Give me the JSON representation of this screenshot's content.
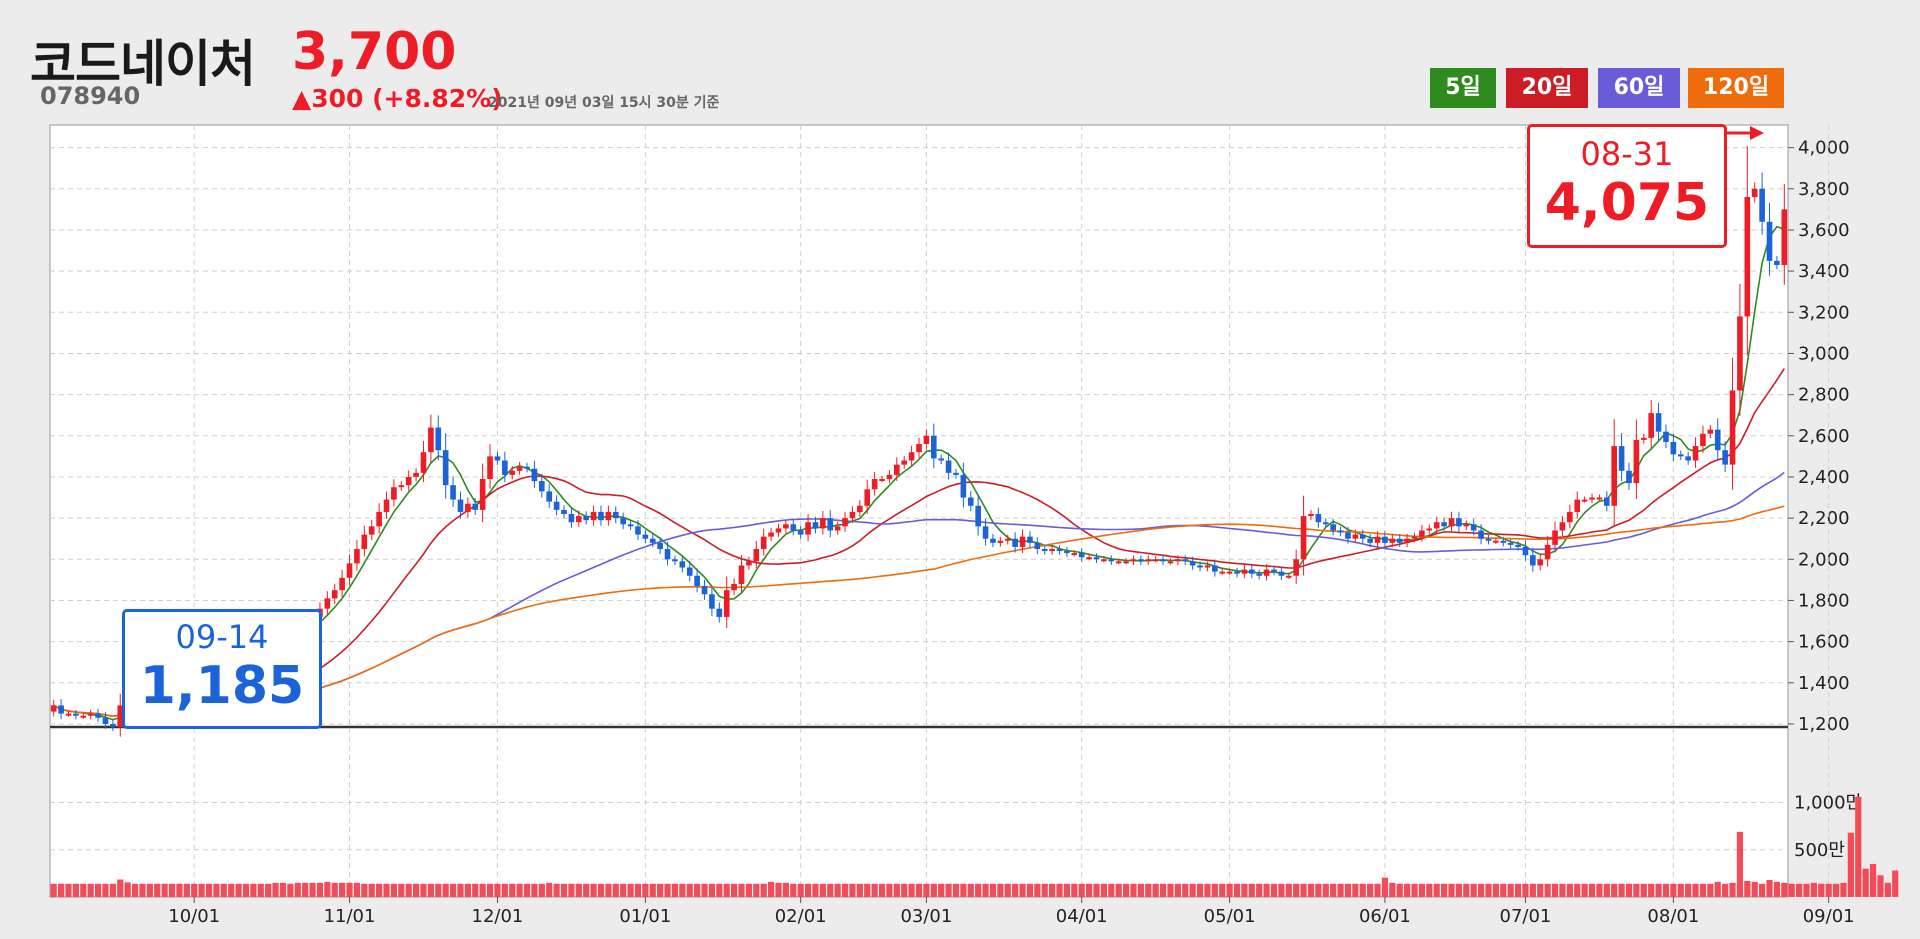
{
  "header": {
    "name": "코드네이처",
    "price": "3,700",
    "code": "078940",
    "change": "▲300 (+8.82%)",
    "timestamp": "2021년 09년 03일 15시 30분 기준"
  },
  "legend": [
    {
      "label": "5일",
      "color": "#2e8b1e"
    },
    {
      "label": "20일",
      "color": "#cc1d26"
    },
    {
      "label": "60일",
      "color": "#6a5bd8"
    },
    {
      "label": "120일",
      "color": "#ef6c0c"
    }
  ],
  "annotations": {
    "low": {
      "date": "09-14",
      "value": "1,185",
      "color": "#1a63d8"
    },
    "high": {
      "date": "08-31",
      "value": "4,075",
      "color": "#ee1c25"
    }
  },
  "chart_data": {
    "type": "candlestick",
    "price_axis": {
      "ylim": [
        1190,
        4110
      ],
      "ticks": [
        "1,200",
        "1,400",
        "1,600",
        "1,800",
        "2,000",
        "2,200",
        "2,400",
        "2,600",
        "2,800",
        "3,000",
        "3,200",
        "3,400",
        "3,600",
        "3,800",
        "4,000"
      ],
      "tick_values": [
        1200,
        1400,
        1600,
        1800,
        2000,
        2200,
        2400,
        2600,
        2800,
        3000,
        3200,
        3400,
        3600,
        3800,
        4000
      ]
    },
    "volume_axis": {
      "ticks": [
        "500만",
        "1,000만"
      ],
      "tick_values": [
        500,
        1000
      ],
      "unit": "만"
    },
    "x_ticks": [
      "10/01",
      "11/01",
      "12/01",
      "01/01",
      "02/01",
      "03/01",
      "04/01",
      "05/01",
      "06/01",
      "07/01",
      "08/01",
      "09/01"
    ],
    "x_tick_index": [
      19,
      40,
      60,
      80,
      101,
      118,
      139,
      159,
      180,
      199,
      219,
      240
    ],
    "colors": {
      "up": "#ee1c25",
      "down": "#1a63d8",
      "volume": "#f44b58"
    },
    "close": [
      1290,
      1250,
      1250,
      1240,
      1240,
      1250,
      1230,
      1200,
      1185,
      1290,
      1250,
      1310,
      1290,
      1280,
      1300,
      1290,
      1300,
      1300,
      1310,
      1310,
      1320,
      1330,
      1340,
      1350,
      1360,
      1380,
      1390,
      1400,
      1460,
      1510,
      1560,
      1590,
      1640,
      1660,
      1690,
      1720,
      1760,
      1810,
      1850,
      1910,
      1980,
      2050,
      2120,
      2160,
      2230,
      2290,
      2350,
      2360,
      2400,
      2420,
      2520,
      2640,
      2530,
      2360,
      2290,
      2230,
      2270,
      2240,
      2390,
      2500,
      2480,
      2410,
      2430,
      2450,
      2440,
      2380,
      2330,
      2280,
      2240,
      2220,
      2180,
      2210,
      2190,
      2230,
      2190,
      2230,
      2200,
      2170,
      2160,
      2120,
      2100,
      2080,
      2050,
      2000,
      1990,
      1960,
      1920,
      1870,
      1830,
      1760,
      1720,
      1850,
      1880,
      1970,
      1990,
      2050,
      2110,
      2130,
      2150,
      2170,
      2140,
      2120,
      2180,
      2150,
      2200,
      2140,
      2160,
      2200,
      2230,
      2260,
      2340,
      2390,
      2390,
      2410,
      2460,
      2480,
      2520,
      2560,
      2600,
      2490,
      2480,
      2420,
      2410,
      2300,
      2260,
      2160,
      2100,
      2080,
      2090,
      2100,
      2060,
      2110,
      2080,
      2050,
      2040,
      2050,
      2040,
      2030,
      2030,
      2010,
      2010,
      2000,
      2000,
      1990,
      1990,
      1990,
      2000,
      1990,
      2000,
      2000,
      1990,
      1990,
      2000,
      1990,
      1970,
      1960,
      1970,
      1940,
      1940,
      1940,
      1930,
      1950,
      1930,
      1920,
      1950,
      1940,
      1920,
      1920,
      2000,
      2210,
      2220,
      2180,
      2170,
      2140,
      2130,
      2100,
      2120,
      2100,
      2080,
      2110,
      2080,
      2100,
      2080,
      2100,
      2110,
      2140,
      2150,
      2180,
      2160,
      2200,
      2160,
      2170,
      2140,
      2100,
      2090,
      2090,
      2080,
      2070,
      2060,
      2020,
      1970,
      2000,
      2070,
      2140,
      2180,
      2230,
      2290,
      2290,
      2300,
      2300,
      2260,
      2550,
      2430,
      2370,
      2580,
      2590,
      2710,
      2620,
      2570,
      2510,
      2500,
      2480,
      2550,
      2610,
      2630,
      2530,
      2460,
      2820,
      3180,
      3760,
      3800,
      3640,
      3450,
      3430,
      3700
    ],
    "open": [
      1260,
      1290,
      1250,
      1250,
      1240,
      1240,
      1250,
      1230,
      1200,
      1185,
      1290,
      1250,
      1310,
      1290,
      1280,
      1300,
      1290,
      1300,
      1300,
      1310,
      1310,
      1320,
      1330,
      1340,
      1350,
      1360,
      1380,
      1390,
      1400,
      1460,
      1510,
      1560,
      1590,
      1640,
      1660,
      1690,
      1720,
      1760,
      1810,
      1850,
      1910,
      1980,
      2050,
      2120,
      2160,
      2230,
      2290,
      2350,
      2360,
      2400,
      2420,
      2520,
      2640,
      2530,
      2360,
      2290,
      2230,
      2270,
      2240,
      2390,
      2500,
      2480,
      2410,
      2430,
      2450,
      2440,
      2380,
      2330,
      2280,
      2240,
      2220,
      2180,
      2210,
      2190,
      2230,
      2190,
      2230,
      2200,
      2170,
      2160,
      2120,
      2100,
      2080,
      2050,
      2000,
      1990,
      1960,
      1920,
      1870,
      1830,
      1760,
      1720,
      1850,
      1880,
      1970,
      1990,
      2050,
      2110,
      2130,
      2150,
      2170,
      2140,
      2120,
      2180,
      2150,
      2200,
      2140,
      2160,
      2200,
      2230,
      2260,
      2340,
      2390,
      2390,
      2410,
      2460,
      2480,
      2520,
      2560,
      2600,
      2490,
      2480,
      2420,
      2410,
      2300,
      2260,
      2160,
      2100,
      2080,
      2090,
      2100,
      2060,
      2110,
      2080,
      2050,
      2040,
      2050,
      2040,
      2030,
      2030,
      2010,
      2010,
      2000,
      2000,
      1990,
      1990,
      1990,
      2000,
      1990,
      2000,
      2000,
      1990,
      1990,
      2000,
      1990,
      1970,
      1960,
      1970,
      1940,
      1940,
      1940,
      1930,
      1950,
      1930,
      1920,
      1950,
      1940,
      1920,
      1920,
      2000,
      2210,
      2220,
      2180,
      2170,
      2140,
      2130,
      2100,
      2120,
      2100,
      2080,
      2110,
      2080,
      2100,
      2080,
      2100,
      2110,
      2140,
      2150,
      2180,
      2160,
      2200,
      2160,
      2170,
      2140,
      2100,
      2090,
      2090,
      2080,
      2070,
      2060,
      2020,
      1970,
      2000,
      2070,
      2140,
      2180,
      2230,
      2290,
      2290,
      2300,
      2300,
      2260,
      2550,
      2430,
      2370,
      2580,
      2590,
      2710,
      2620,
      2570,
      2510,
      2500,
      2480,
      2550,
      2610,
      2630,
      2530,
      2460,
      2820,
      3180,
      3760,
      3800,
      3640,
      3450,
      3430
    ],
    "volume": [
      140,
      140,
      140,
      140,
      140,
      140,
      140,
      140,
      140,
      185,
      155,
      140,
      140,
      140,
      140,
      140,
      140,
      140,
      140,
      140,
      140,
      140,
      140,
      140,
      140,
      140,
      140,
      140,
      140,
      140,
      150,
      150,
      140,
      150,
      150,
      150,
      150,
      160,
      150,
      150,
      150,
      150,
      140,
      140,
      140,
      140,
      140,
      140,
      140,
      140,
      140,
      140,
      140,
      140,
      140,
      140,
      140,
      140,
      140,
      140,
      140,
      140,
      140,
      140,
      140,
      140,
      140,
      150,
      140,
      140,
      140,
      140,
      140,
      140,
      140,
      140,
      140,
      140,
      140,
      140,
      140,
      140,
      140,
      140,
      140,
      140,
      140,
      140,
      140,
      140,
      140,
      140,
      140,
      140,
      140,
      140,
      140,
      160,
      150,
      150,
      140,
      140,
      140,
      140,
      140,
      140,
      140,
      140,
      140,
      140,
      140,
      140,
      140,
      140,
      140,
      140,
      140,
      140,
      140,
      140,
      140,
      140,
      140,
      140,
      140,
      140,
      140,
      140,
      140,
      140,
      140,
      140,
      140,
      140,
      140,
      140,
      140,
      140,
      140,
      140,
      140,
      140,
      140,
      140,
      140,
      140,
      140,
      140,
      140,
      140,
      140,
      140,
      140,
      140,
      140,
      140,
      140,
      140,
      140,
      140,
      140,
      140,
      140,
      140,
      140,
      140,
      140,
      140,
      140,
      140,
      140,
      140,
      140,
      140,
      140,
      140,
      140,
      140,
      140,
      140,
      205,
      150,
      140,
      140,
      140,
      140,
      140,
      140,
      140,
      140,
      140,
      140,
      140,
      140,
      140,
      140,
      140,
      140,
      140,
      140,
      140,
      140,
      140,
      140,
      140,
      140,
      140,
      140,
      140,
      140,
      140,
      140,
      140,
      140,
      140,
      140,
      140,
      140,
      140,
      140,
      140,
      140,
      140,
      140,
      140,
      160,
      140,
      150,
      690,
      170,
      160,
      140,
      180,
      160,
      150,
      140,
      140,
      140,
      150,
      140,
      140,
      140,
      150,
      680,
      1060,
      300,
      350,
      230,
      150,
      280
    ]
  }
}
